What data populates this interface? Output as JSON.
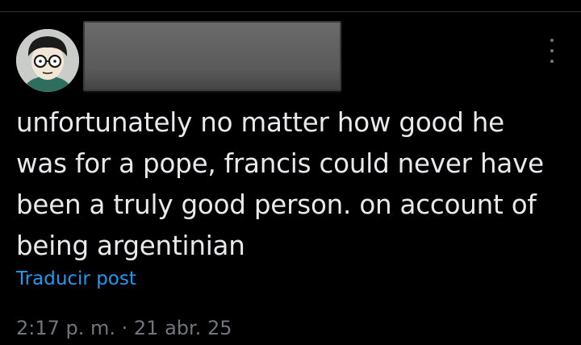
{
  "post": {
    "text_lines": [
      "unfortunately no matter how good he",
      "was for a pope, francis could never have",
      "been a truly good person. on account of",
      "being argentinian"
    ],
    "translate_label": "Traducir post",
    "timestamp": "2:17 p. m. · 21 abr. 25"
  },
  "icons": {
    "more": "more-options-icon",
    "avatar": "avatar-cartoon-glasses"
  },
  "colors": {
    "background": "#000000",
    "text": "#e7e9ea",
    "link": "#1d9bf0",
    "muted": "#71767b"
  }
}
